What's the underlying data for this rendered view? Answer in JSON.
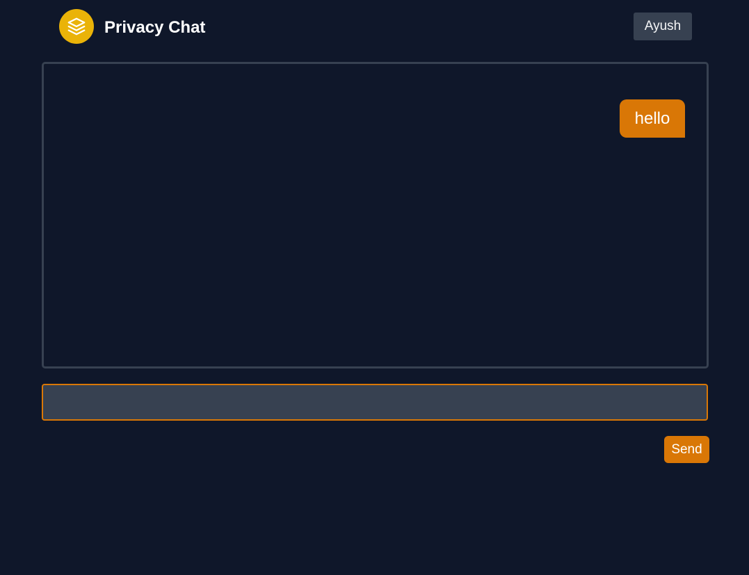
{
  "header": {
    "title": "Privacy Chat",
    "logo_icon": "layers-icon",
    "user_label": "Ayush"
  },
  "chat": {
    "messages": [
      {
        "text": "hello",
        "sender": "self"
      }
    ]
  },
  "composer": {
    "input_value": "",
    "input_placeholder": "",
    "send_label": "Send"
  },
  "colors": {
    "background": "#0f172a",
    "accent": "#d97706",
    "logo": "#eab308",
    "surface": "#374151"
  }
}
